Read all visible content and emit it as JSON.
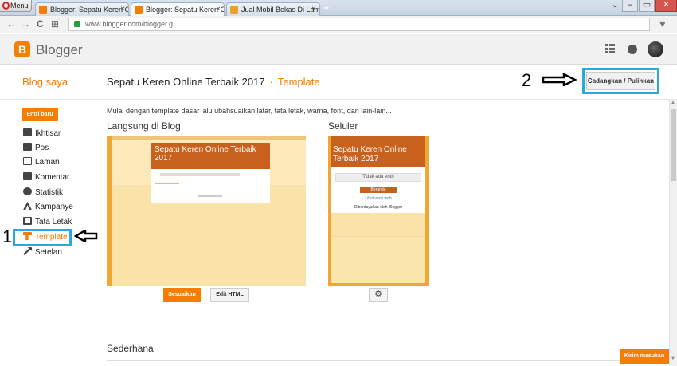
{
  "browser": {
    "menu_label": "Menu",
    "tabs": [
      {
        "label": "Blogger: Sepatu Keren On"
      },
      {
        "label": "Blogger: Sepatu Keren On"
      },
      {
        "label": "Jual Mobil Bekas Di Lampu"
      }
    ],
    "close_glyph": "×",
    "newtab_glyph": "+",
    "url": "www.blogger.com/blogger.g",
    "nav": {
      "back": "←",
      "forward": "→",
      "reload": "C",
      "home": "⊞"
    },
    "window": {
      "minimize": "‒",
      "maximize": "▭",
      "close": "✕",
      "tabs_menu": "⌄"
    },
    "bookmark_glyph": "♥"
  },
  "header": {
    "logo_letter": "B",
    "app_name": "Blogger"
  },
  "titlebar": {
    "blog_list_label": "Blog saya",
    "blog_title": "Sepatu Keren Online Terbaik 2017",
    "separator": "·",
    "section": "Template",
    "backup_button": "Cadangkan / Pulihkan",
    "annotation_2": "2"
  },
  "sidebar": {
    "new_post": "Entri baru",
    "items": [
      {
        "label": "Ikhtisar"
      },
      {
        "label": "Pos"
      },
      {
        "label": "Laman"
      },
      {
        "label": "Komentar"
      },
      {
        "label": "Statistik"
      },
      {
        "label": "Kampanye"
      },
      {
        "label": "Tata Letak"
      },
      {
        "label": "Template"
      },
      {
        "label": "Setelan"
      }
    ],
    "annotation_1": "1"
  },
  "main": {
    "intro": "Mulai dengan template dasar lalu ubahsuaikan latar, tata letak, warna, font, dan lain-lain...",
    "live_heading": "Langsung di Blog",
    "mobile_heading": "Seluler",
    "preview_blog_title": "Sepatu Keren Online Terbaik 2017",
    "mobile_empty": "Tidak ada entri",
    "mobile_home_btn": "Beranda",
    "mobile_web": "Lihat versi web",
    "mobile_by": "Diberdayakan oleh Blogger",
    "customize_button": "Sesuaikan",
    "edit_html_button": "Edit HTML",
    "mobile_settings_glyph": "⚙",
    "simple_heading": "Sederhana",
    "feedback_button": "Kirim masukan"
  },
  "colors": {
    "accent": "#f57d00",
    "highlight": "#2aa7df",
    "preview_header": "#c8611e"
  }
}
